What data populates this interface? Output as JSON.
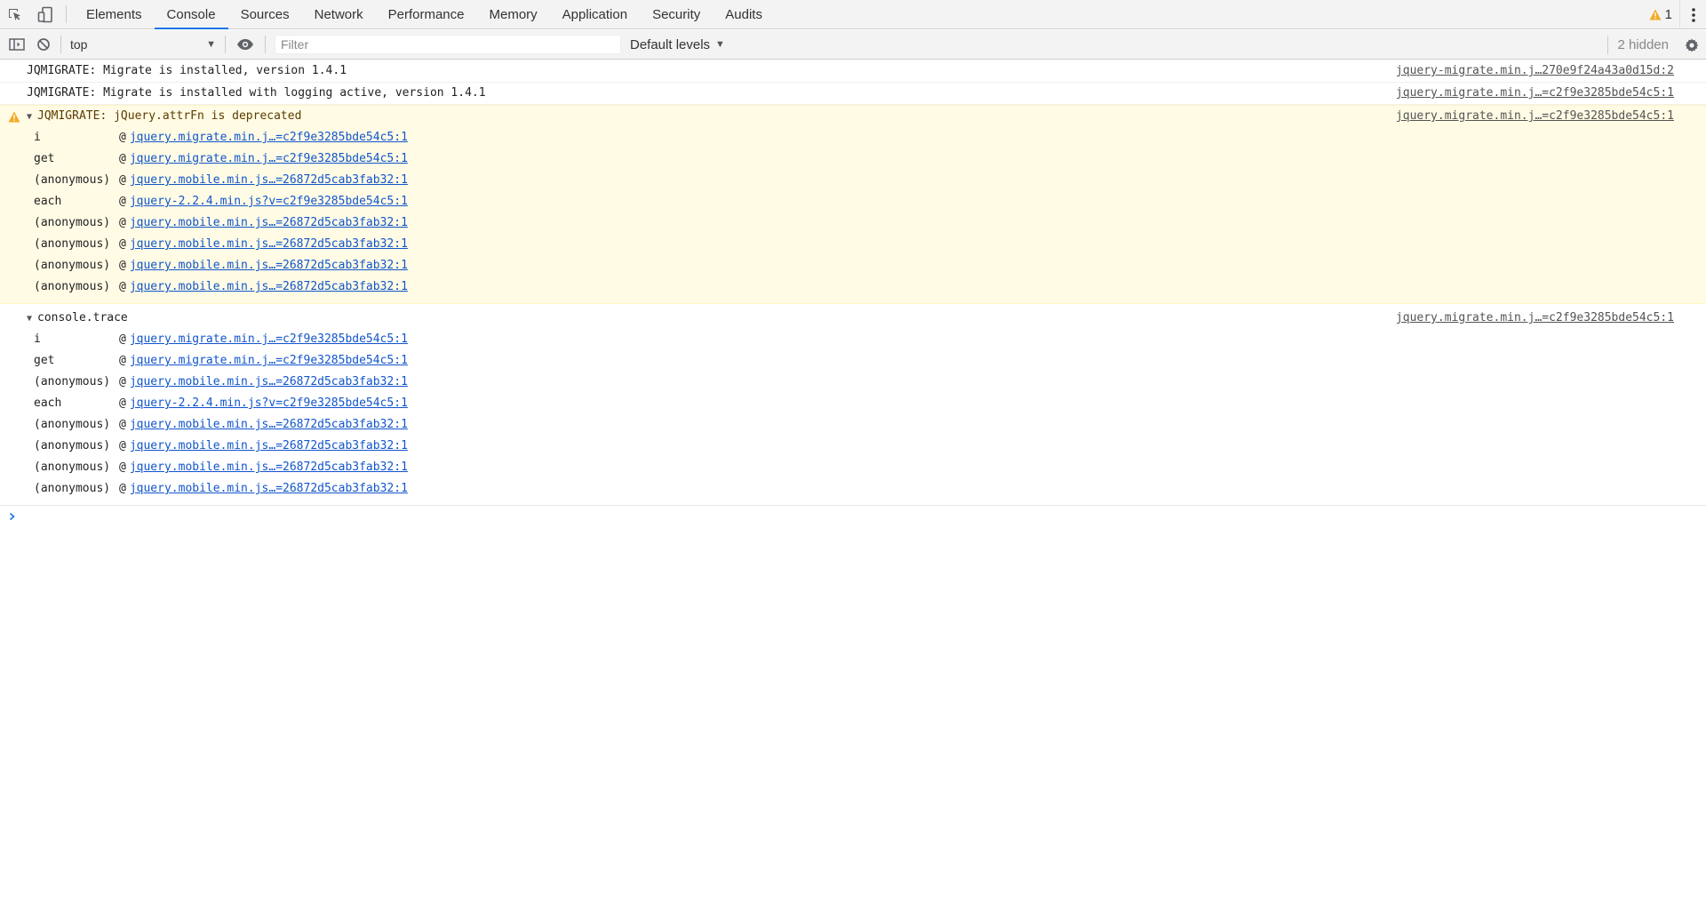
{
  "tabs": [
    {
      "label": "Elements"
    },
    {
      "label": "Console"
    },
    {
      "label": "Sources"
    },
    {
      "label": "Network"
    },
    {
      "label": "Performance"
    },
    {
      "label": "Memory"
    },
    {
      "label": "Application"
    },
    {
      "label": "Security"
    },
    {
      "label": "Audits"
    }
  ],
  "selected_tab": "Console",
  "warning_count": "1",
  "toolbar": {
    "context": "top",
    "filter_placeholder": "Filter",
    "levels": "Default levels",
    "hidden": "2 hidden"
  },
  "messages": {
    "m1": {
      "text": "JQMIGRATE: Migrate is installed, version 1.4.1",
      "source": "jquery-migrate.min.j…270e9f24a43a0d15d:2"
    },
    "m2": {
      "text": "JQMIGRATE: Migrate is installed with logging active, version 1.4.1",
      "source": "jquery.migrate.min.j…=c2f9e3285bde54c5:1"
    },
    "warning": {
      "text": "JQMIGRATE: jQuery.attrFn is deprecated",
      "source": "jquery.migrate.min.j…=c2f9e3285bde54c5:1",
      "stack": [
        {
          "fn": "i",
          "link": "jquery.migrate.min.j…=c2f9e3285bde54c5:1"
        },
        {
          "fn": "get",
          "link": "jquery.migrate.min.j…=c2f9e3285bde54c5:1"
        },
        {
          "fn": "(anonymous)",
          "link": "jquery.mobile.min.js…=26872d5cab3fab32:1"
        },
        {
          "fn": "each",
          "link": "jquery-2.2.4.min.js?v=c2f9e3285bde54c5:1"
        },
        {
          "fn": "(anonymous)",
          "link": "jquery.mobile.min.js…=26872d5cab3fab32:1"
        },
        {
          "fn": "(anonymous)",
          "link": "jquery.mobile.min.js…=26872d5cab3fab32:1"
        },
        {
          "fn": "(anonymous)",
          "link": "jquery.mobile.min.js…=26872d5cab3fab32:1"
        },
        {
          "fn": "(anonymous)",
          "link": "jquery.mobile.min.js…=26872d5cab3fab32:1"
        }
      ]
    },
    "trace": {
      "text": "console.trace",
      "source": "jquery.migrate.min.j…=c2f9e3285bde54c5:1",
      "stack": [
        {
          "fn": "i",
          "link": "jquery.migrate.min.j…=c2f9e3285bde54c5:1"
        },
        {
          "fn": "get",
          "link": "jquery.migrate.min.j…=c2f9e3285bde54c5:1"
        },
        {
          "fn": "(anonymous)",
          "link": "jquery.mobile.min.js…=26872d5cab3fab32:1"
        },
        {
          "fn": "each",
          "link": "jquery-2.2.4.min.js?v=c2f9e3285bde54c5:1"
        },
        {
          "fn": "(anonymous)",
          "link": "jquery.mobile.min.js…=26872d5cab3fab32:1"
        },
        {
          "fn": "(anonymous)",
          "link": "jquery.mobile.min.js…=26872d5cab3fab32:1"
        },
        {
          "fn": "(anonymous)",
          "link": "jquery.mobile.min.js…=26872d5cab3fab32:1"
        },
        {
          "fn": "(anonymous)",
          "link": "jquery.mobile.min.js…=26872d5cab3fab32:1"
        }
      ]
    }
  },
  "icons": {
    "inspect": "inspect-element-icon",
    "device": "device-toolbar-icon",
    "sidebar": "show-console-sidebar-icon",
    "clear": "clear-console-icon",
    "eye": "live-expression-eye-icon",
    "gear": "console-settings-gear-icon",
    "kebab": "customize-devtools-kebab-icon",
    "warning": "warning-triangle-icon",
    "prompt": "console-prompt-chevron-icon"
  },
  "colors": {
    "accent": "#1a73e8",
    "warning_bg": "#fffbe5",
    "warning_icon": "#f2ab26",
    "link": "#1155cc"
  }
}
